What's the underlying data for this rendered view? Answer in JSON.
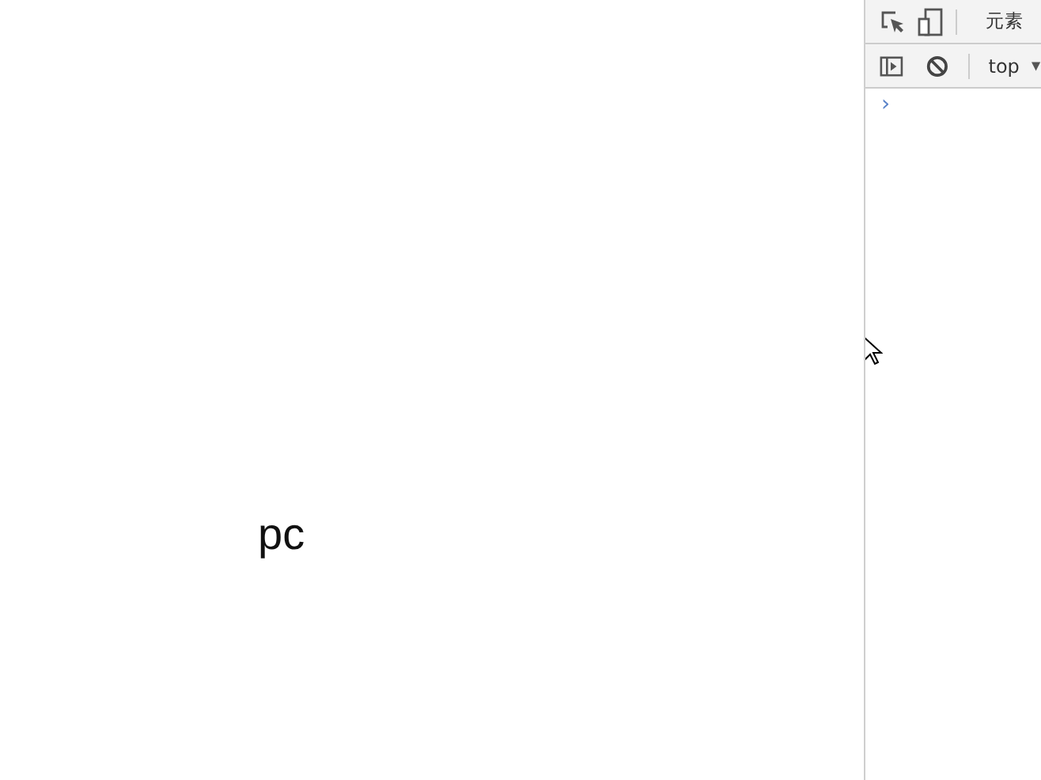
{
  "page": {
    "text": "pc"
  },
  "devtools": {
    "tabs": [
      {
        "label": "元素"
      }
    ],
    "context": "top",
    "prompt": "›"
  }
}
